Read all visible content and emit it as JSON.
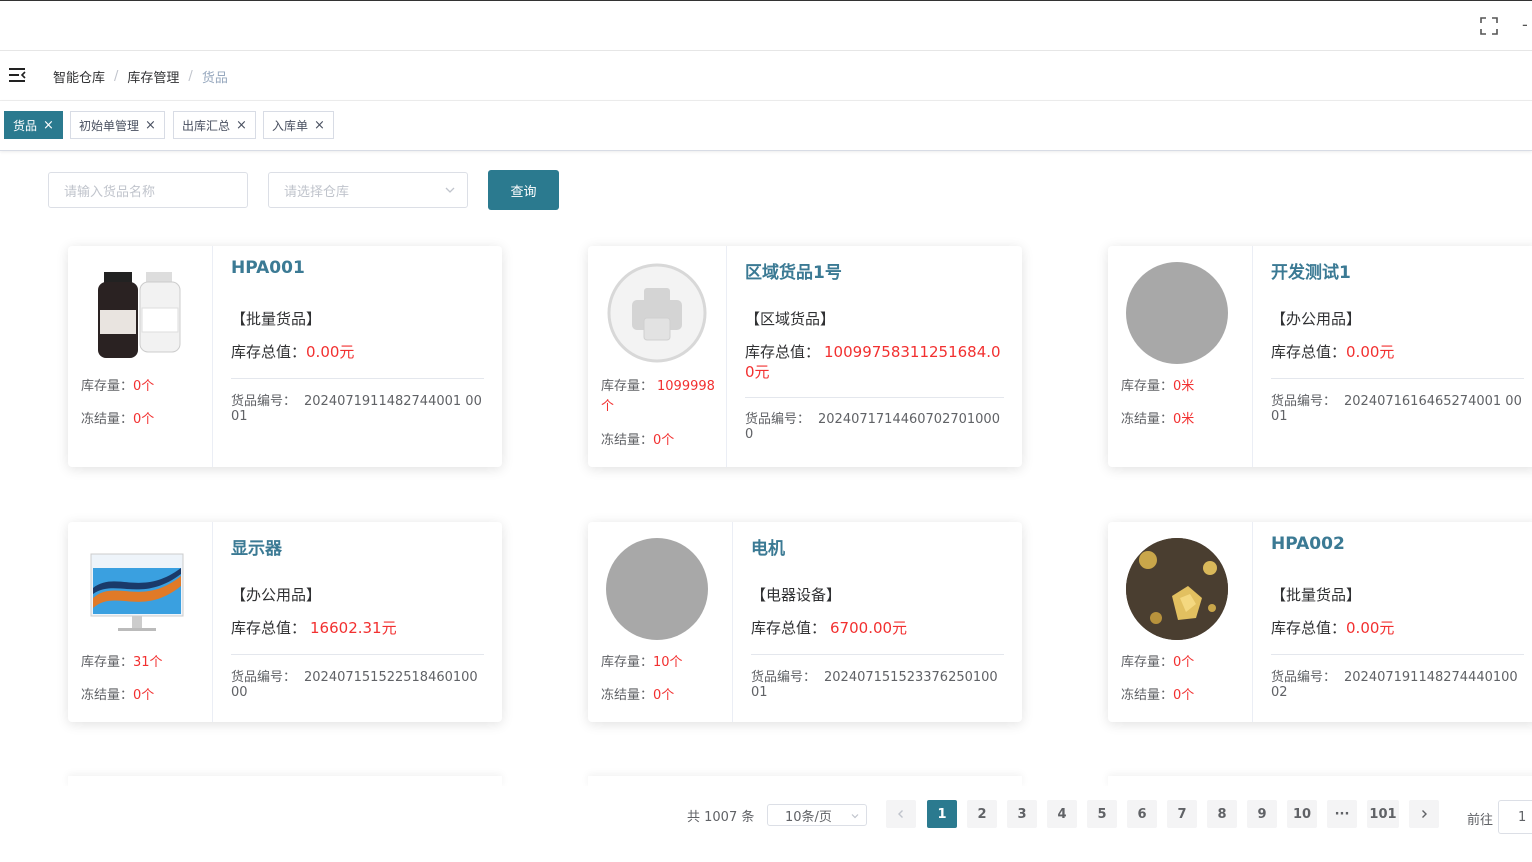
{
  "topbar": {
    "fullscreen_icon": "fullscreen-icon",
    "dash": "-"
  },
  "breadcrumb": {
    "items": [
      "智能仓库",
      "库存管理",
      "货品"
    ],
    "separator": "/"
  },
  "tags": [
    {
      "label": "货品",
      "active": true
    },
    {
      "label": "初始单管理",
      "active": false
    },
    {
      "label": "出库汇总",
      "active": false
    },
    {
      "label": "入库单",
      "active": false
    }
  ],
  "filters": {
    "name_placeholder": "请输入货品名称",
    "warehouse_placeholder": "请选择仓库",
    "query_label": "查询"
  },
  "labels": {
    "stock": "库存量：",
    "frozen": "冻结量：",
    "total_value": "库存总值：",
    "code": "货品编号："
  },
  "products": [
    {
      "name": "HPA001",
      "category": "【批量货品】",
      "total": "0.00元",
      "stock": "0个",
      "frozen": "0个",
      "code": "2024071911482744001 0001",
      "image": "bottles"
    },
    {
      "name": "区域货品1号",
      "category": "【区域货品】",
      "total": "10099758311251684.00元",
      "stock": "1099998个",
      "frozen": "0个",
      "code": "20240717144607027010000",
      "image": "placeholder-printer"
    },
    {
      "name": "开发测试1",
      "category": "【办公用品】",
      "total": "0.00元",
      "stock": "0米",
      "frozen": "0米",
      "code": "2024071616465274001 0001",
      "image": "broken-gray"
    },
    {
      "name": "显示器",
      "category": "【办公用品】",
      "total": "16602.31元",
      "stock": "31个",
      "frozen": "0个",
      "code": "202407151522518460100 00",
      "image": "monitor"
    },
    {
      "name": "电机",
      "category": "【电器设备】",
      "total": "6700.00元",
      "stock": "10个",
      "frozen": "0个",
      "code": "202407151523376250100 01",
      "image": "broken-gray"
    },
    {
      "name": "HPA002",
      "category": "【批量货品】",
      "total": "0.00元",
      "stock": "0个",
      "frozen": "0个",
      "code": "202407191148274440100 02",
      "image": "gold"
    }
  ],
  "pagination": {
    "total": "共 1007 条",
    "page_size": "10条/页",
    "pages": [
      "1",
      "2",
      "3",
      "4",
      "5",
      "6",
      "7",
      "8",
      "9",
      "10",
      "···",
      "101"
    ],
    "current": "1",
    "goto_label": "前往",
    "goto_value": "1"
  },
  "colors": {
    "primary": "#2b7a8f",
    "value_red": "#f23030",
    "title_blue": "#3b7a94"
  }
}
